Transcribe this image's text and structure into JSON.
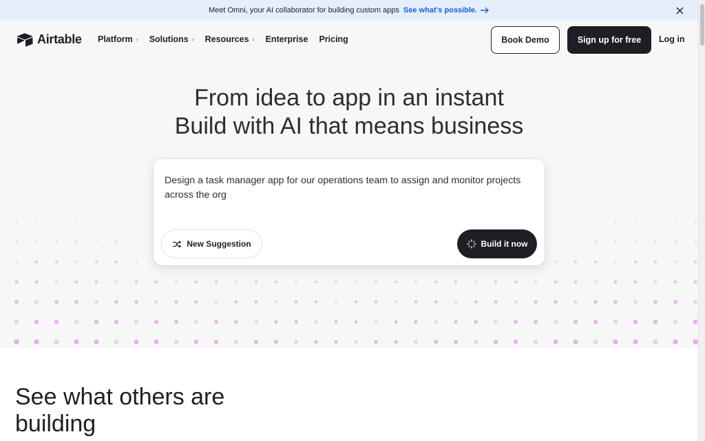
{
  "banner": {
    "text": "Meet Omni, your AI collaborator for building custom apps",
    "link_label": "See what's possible.",
    "arrow_icon": "arrow-right-icon",
    "close_icon": "close-icon"
  },
  "nav": {
    "logo_text": "Airtable",
    "logo_icon": "airtable-logo-icon",
    "items": [
      {
        "label": "Platform",
        "has_menu": true
      },
      {
        "label": "Solutions",
        "has_menu": true
      },
      {
        "label": "Resources",
        "has_menu": true
      },
      {
        "label": "Enterprise",
        "has_menu": false
      },
      {
        "label": "Pricing",
        "has_menu": false
      }
    ],
    "chevron": "›",
    "book_demo": "Book Demo",
    "sign_up": "Sign up for free",
    "log_in": "Log in"
  },
  "hero": {
    "line1": "From idea to app in an instant",
    "line2": "Build with AI that means business",
    "prompt": "Design a task manager app for our operations team to assign and monitor projects across the org",
    "new_suggestion": "New Suggestion",
    "shuffle_icon": "shuffle-icon",
    "build_label": "Build it now",
    "spinner_icon": "spinner-icon"
  },
  "section": {
    "line1": "See what others are",
    "line2": "building"
  },
  "colors": {
    "banner_bg": "#e6eefb",
    "link": "#1b5ed6",
    "hero_bg": "#f7f7f7",
    "dark": "#1d1f25",
    "dot_pink": "#e7a8f0",
    "dot_grey": "#d9d9dc"
  }
}
